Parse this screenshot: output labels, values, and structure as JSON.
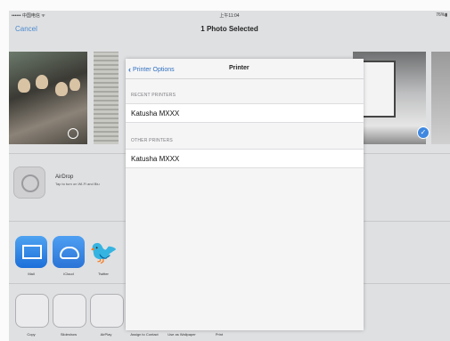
{
  "status_bar": {
    "carrier": "•••••• 中国电信 ᯤ",
    "time": "上午11:04",
    "battery": "76%▮"
  },
  "nav": {
    "cancel": "Cancel",
    "title": "1 Photo Selected"
  },
  "airdrop": {
    "name": "AirDrop",
    "description": "Tap to turn on Wi-Fi and Blu"
  },
  "apps": [
    {
      "label": "Mail"
    },
    {
      "label": "iCloud"
    },
    {
      "label": "Twitter"
    }
  ],
  "actions": [
    {
      "label": "Copy"
    },
    {
      "label": "Slideshow"
    },
    {
      "label": "AirPlay"
    },
    {
      "label": "Assign to Contact"
    },
    {
      "label": "Use as Wallpaper"
    },
    {
      "label": "Print"
    }
  ],
  "popover": {
    "back_label": "Printer Options",
    "title": "Printer",
    "recent_header": "RECENT PRINTERS",
    "recent_printer": "Katusha MXXX",
    "other_header": "OTHER PRINTERS",
    "other_printer": "Katusha MXXX"
  },
  "colors": {
    "accent": "#4a89ce",
    "check": "#3f87e0"
  }
}
